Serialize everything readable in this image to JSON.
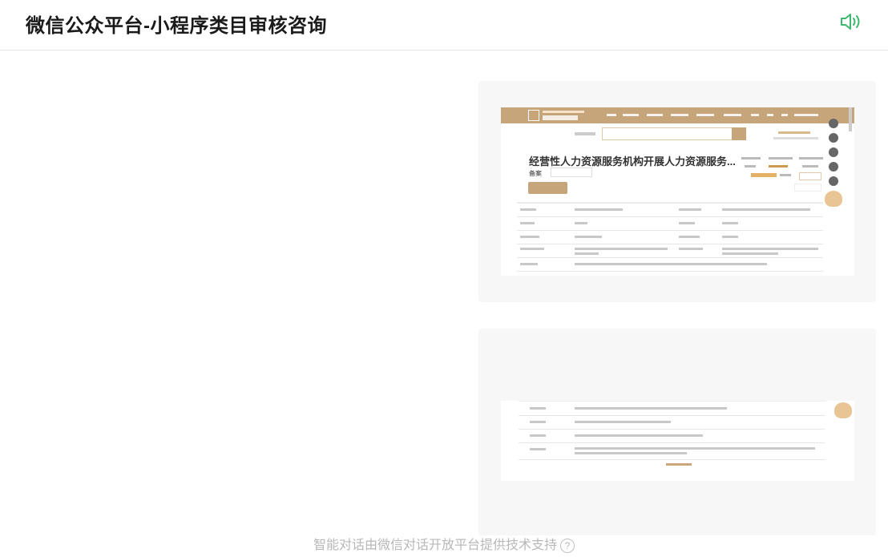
{
  "header": {
    "title": "微信公众平台-小程序类目审核咨询",
    "speaker_icon": "speaker-icon"
  },
  "image1": {
    "page_title": "经营性人力资源服务机构开展人力资源服务...",
    "sub_label": "备案"
  },
  "footer": {
    "text": "智能对话由微信对话开放平台提供技术支持",
    "help_icon": "?"
  },
  "colors": {
    "accent_green": "#3cb86f",
    "brand_gold": "#c7a57a"
  }
}
